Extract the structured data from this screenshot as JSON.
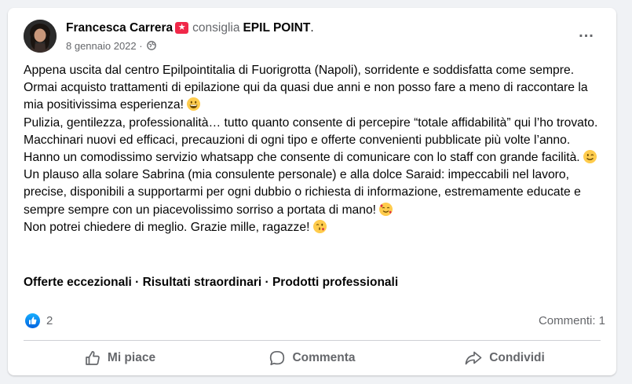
{
  "post": {
    "author": "Francesca Carrera",
    "recommend_verb": "consiglia",
    "page_name": "EPIL POINT",
    "page_suffix": ".",
    "date": "8 gennaio 2022",
    "date_separator": "·",
    "more_label": "...",
    "paragraphs": [
      {
        "text": "Appena uscita dal centro Epilpointitalia di Fuorigrotta (Napoli), sorridente e soddisfatta come sempre. Ormai acquisto trattamenti di epilazione qui da quasi due anni e non posso fare a meno di raccontare la mia positivissima esperienza!",
        "emoji": "grinning-face"
      },
      {
        "text": "Pulizia, gentilezza, professionalità… tutto quanto consente di percepire “totale affidabilità” qui l’ho trovato. Macchinari nuovi ed efficaci, precauzioni di ogni tipo e offerte convenienti pubblicate più volte l’anno. Hanno un comodissimo servizio whatsapp che consente di comunicare con lo staff con grande facilità.",
        "emoji": "winking-face"
      },
      {
        "text": "Un plauso alla solare Sabrina (mia consulente personale) e alla dolce Saraid: impeccabili nel lavoro, precise, disponibili a supportarmi per ogni dubbio o richiesta di informazione, estremamente educate e sempre sempre con un piacevolissimo sorriso a portata di mano!",
        "emoji": "smiling-face-with-hearts"
      },
      {
        "text": "Non potrei chiedere di meglio. Grazie mille, ragazze!",
        "emoji": "face-blowing-kiss"
      }
    ],
    "tags": "Offerte eccezionali · Risultati straordinari · Prodotti professionali",
    "like_count": "2",
    "comments_label": "Commenti: 1",
    "actions": {
      "like": "Mi piace",
      "comment": "Commenta",
      "share": "Condividi"
    }
  },
  "colors": {
    "background": "#f0f2f5",
    "card": "#ffffff",
    "secondary_text": "#65676b",
    "recommend_badge": "#f02849",
    "like_blue": "#1877f2"
  },
  "icons": {
    "globe": "globe-icon",
    "recommend": "recommend-star-icon",
    "like_reaction": "like-reaction-icon",
    "like_action": "thumbs-up-icon",
    "comment_action": "comment-bubble-icon",
    "share_action": "share-arrow-icon"
  }
}
